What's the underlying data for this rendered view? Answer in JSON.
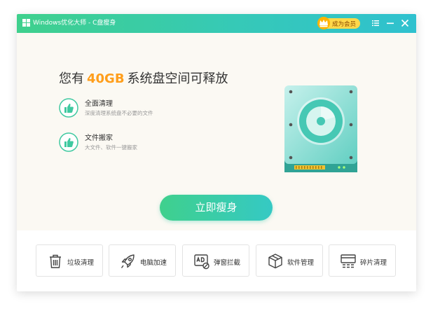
{
  "window": {
    "title": "Windows优化大师 - C盘瘦身",
    "vip_label": "成为会员"
  },
  "main": {
    "headline_prefix": "您有",
    "headline_size": "40GB",
    "headline_suffix": "系统盘空间可释放",
    "features": [
      {
        "title": "全面清理",
        "desc": "深度清理系统盘不必要的文件",
        "icon": "thumbs-up-icon"
      },
      {
        "title": "文件搬家",
        "desc": "大文件、软件一键搬家",
        "icon": "thumbs-up-icon"
      }
    ],
    "cta_label": "立即瘦身"
  },
  "tools": [
    {
      "label": "垃圾清理",
      "icon": "trash-icon"
    },
    {
      "label": "电脑加速",
      "icon": "rocket-icon"
    },
    {
      "label": "弹窗拦截",
      "icon": "ad-block-icon"
    },
    {
      "label": "软件管理",
      "icon": "package-icon"
    },
    {
      "label": "碎片清理",
      "icon": "defrag-icon"
    }
  ],
  "colors": {
    "accent_green": "#3fd08d",
    "accent_teal": "#2fc1cf",
    "highlight_orange": "#ff9e1b",
    "vip_yellow": "#ffd84a"
  }
}
